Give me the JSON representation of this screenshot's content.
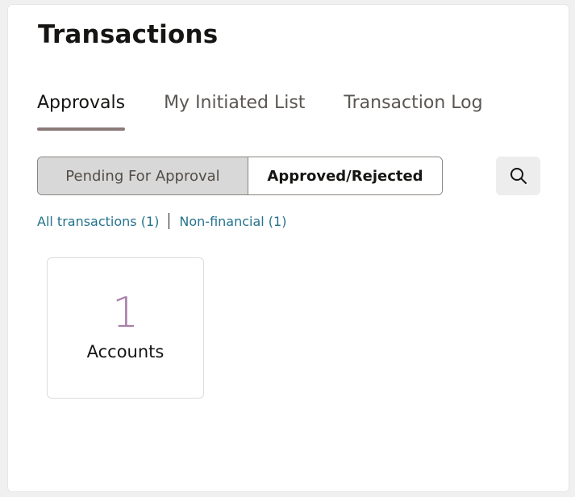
{
  "header": {
    "title": "Transactions"
  },
  "tabs": [
    {
      "label": "Approvals",
      "active": true
    },
    {
      "label": "My Initiated List",
      "active": false
    },
    {
      "label": "Transaction Log",
      "active": false
    }
  ],
  "segments": {
    "selected": "Pending For Approval",
    "other": "Approved/Rejected"
  },
  "search": {
    "icon": "search-icon"
  },
  "filters": [
    {
      "label": "All transactions (1)"
    },
    {
      "label": "Non-financial (1)"
    }
  ],
  "cards": [
    {
      "count": "1",
      "label": "Accounts"
    }
  ],
  "colors": {
    "accent_underline": "#8a7a78",
    "link": "#25738c",
    "count": "#a87ea8",
    "selected_segment_bg": "#d8d8d8"
  }
}
